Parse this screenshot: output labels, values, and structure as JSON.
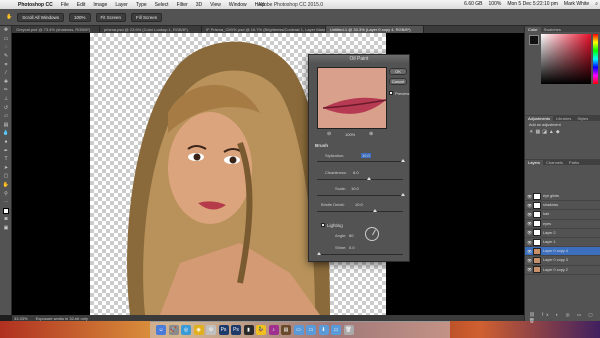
{
  "menubar": {
    "app": "Photoshop CC",
    "items": [
      "File",
      "Edit",
      "Image",
      "Layer",
      "Type",
      "Select",
      "Filter",
      "3D",
      "View",
      "Window",
      "Help"
    ],
    "center_title": "Adobe Photoshop CC 2015.0",
    "storage": "6.60 GB",
    "battery": "100%",
    "clock": "Mon 5 Dec 5:22:10 pm",
    "user": "Mark White"
  },
  "options": {
    "scroll_all": "Scroll All Windows",
    "zoom": "100%",
    "fit_screen": "Fit Screen",
    "fill_screen": "Fill Screen"
  },
  "tabs": [
    "Greycal.psd @ 73.4% (shadows, RGB/8*)",
    "prisma.psd @ 23.6% (Color Lookup 1, RGB/8*)",
    "IF Prisma_CMYK.psd @ 16.7% (Brightness/Contrast 1, Layer Mask/8)",
    "Untitled-1 @ 33.3% (Layer 0 copy 4, RGB/8*)"
  ],
  "statusbar": {
    "zoom": "33.33%",
    "info": "Exposure works in 32-bit only"
  },
  "dialog": {
    "title": "Oil Paint",
    "ok": "OK",
    "cancel": "Cancel",
    "preview": "Preview",
    "zoom": "100%",
    "brush": "Brush",
    "stylization_label": "Stylization:",
    "stylization_value": "10.0",
    "cleanliness_label": "Cleanliness:",
    "cleanliness_value": "6.0",
    "scale_label": "Scale:",
    "scale_value": "10.0",
    "bristle_label": "Bristle Detail:",
    "bristle_value": "10.0",
    "lighting": "Lighting",
    "angle_label": "Angle:",
    "angle_value": "60",
    "shine_label": "Shine:",
    "shine_value": "0.0"
  },
  "panel": {
    "color_tab": "Color",
    "swatches_tab": "Swatches",
    "adjustments_tab": "Adjustments",
    "libraries_tab": "Libraries",
    "styles_tab": "Styles",
    "add_adjustment": "Add an adjustment",
    "layers_tab": "Layers",
    "channels_tab": "Channels",
    "paths_tab": "Paths",
    "layers": [
      "eye glints",
      "shadows",
      "hair",
      "eyes",
      "Layer 2",
      "Layer 1",
      "Layer 0 copy 4",
      "Layer 0 copy 3",
      "Layer 0 copy 2"
    ]
  },
  "colors": {
    "accent": "#3d6fbf",
    "panel": "#535353"
  }
}
